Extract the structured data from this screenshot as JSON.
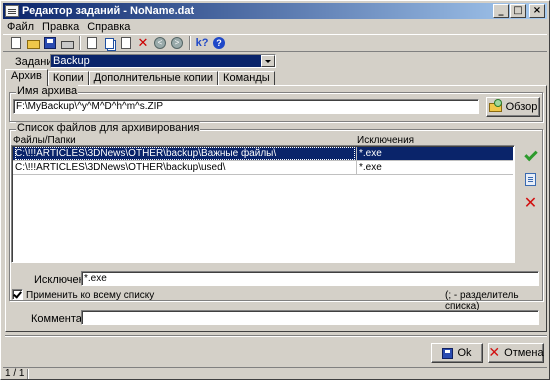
{
  "window": {
    "title": "Редактор заданий - NoName.dat"
  },
  "titlebar_buttons": {
    "minimize": "_",
    "maximize": "□",
    "close": "×"
  },
  "menu": [
    "Файл",
    "Правка",
    "Справка"
  ],
  "toolbar": {
    "icons": [
      "new-document-icon",
      "open-folder-icon",
      "save-icon",
      "print-icon",
      "copy-icon",
      "paste-icon",
      "clipboard-icon",
      "cut-icon",
      "back-icon",
      "forward-icon",
      "whats-this-icon",
      "help-icon"
    ],
    "back_glyph": "<",
    "forward_glyph": ">",
    "whats_this_glyph": "k?",
    "help_glyph": "?"
  },
  "task": {
    "label": "Задание",
    "value": "Backup"
  },
  "tabs": [
    {
      "label": "Архив",
      "active": true
    },
    {
      "label": "Копии",
      "active": false
    },
    {
      "label": "Дополнительные копии",
      "active": false
    },
    {
      "label": "Команды",
      "active": false
    }
  ],
  "archive": {
    "group_title": "Имя архива",
    "name_value": "F:\\MyBackup\\^y^M^D^h^m^s.ZIP",
    "browse_label": "Обзор"
  },
  "files": {
    "group_title": "Список файлов для архивирования",
    "columns": [
      "Файлы/Папки",
      "Исключения"
    ],
    "rows": [
      {
        "path": "C:\\!!!ARTICLES\\3DNews\\OTHER\\backup\\Важные файлы\\",
        "exclusions": "*.exe",
        "selected": true
      },
      {
        "path": "C:\\!!!ARTICLES\\3DNews\\OTHER\\backup\\used\\",
        "exclusions": "*.exe",
        "selected": false
      }
    ],
    "exclusions_label": "Исключения",
    "exclusions_value": "*.exe",
    "apply_all_label": "Применить ко всему списку",
    "apply_all_checked": true,
    "separator_hint": "(; - разделитель списка)"
  },
  "comment": {
    "label": "Комментарий",
    "value": ""
  },
  "buttons": {
    "ok": "Ok",
    "cancel": "Отмена"
  },
  "statusbar": {
    "position": "1 / 1"
  }
}
